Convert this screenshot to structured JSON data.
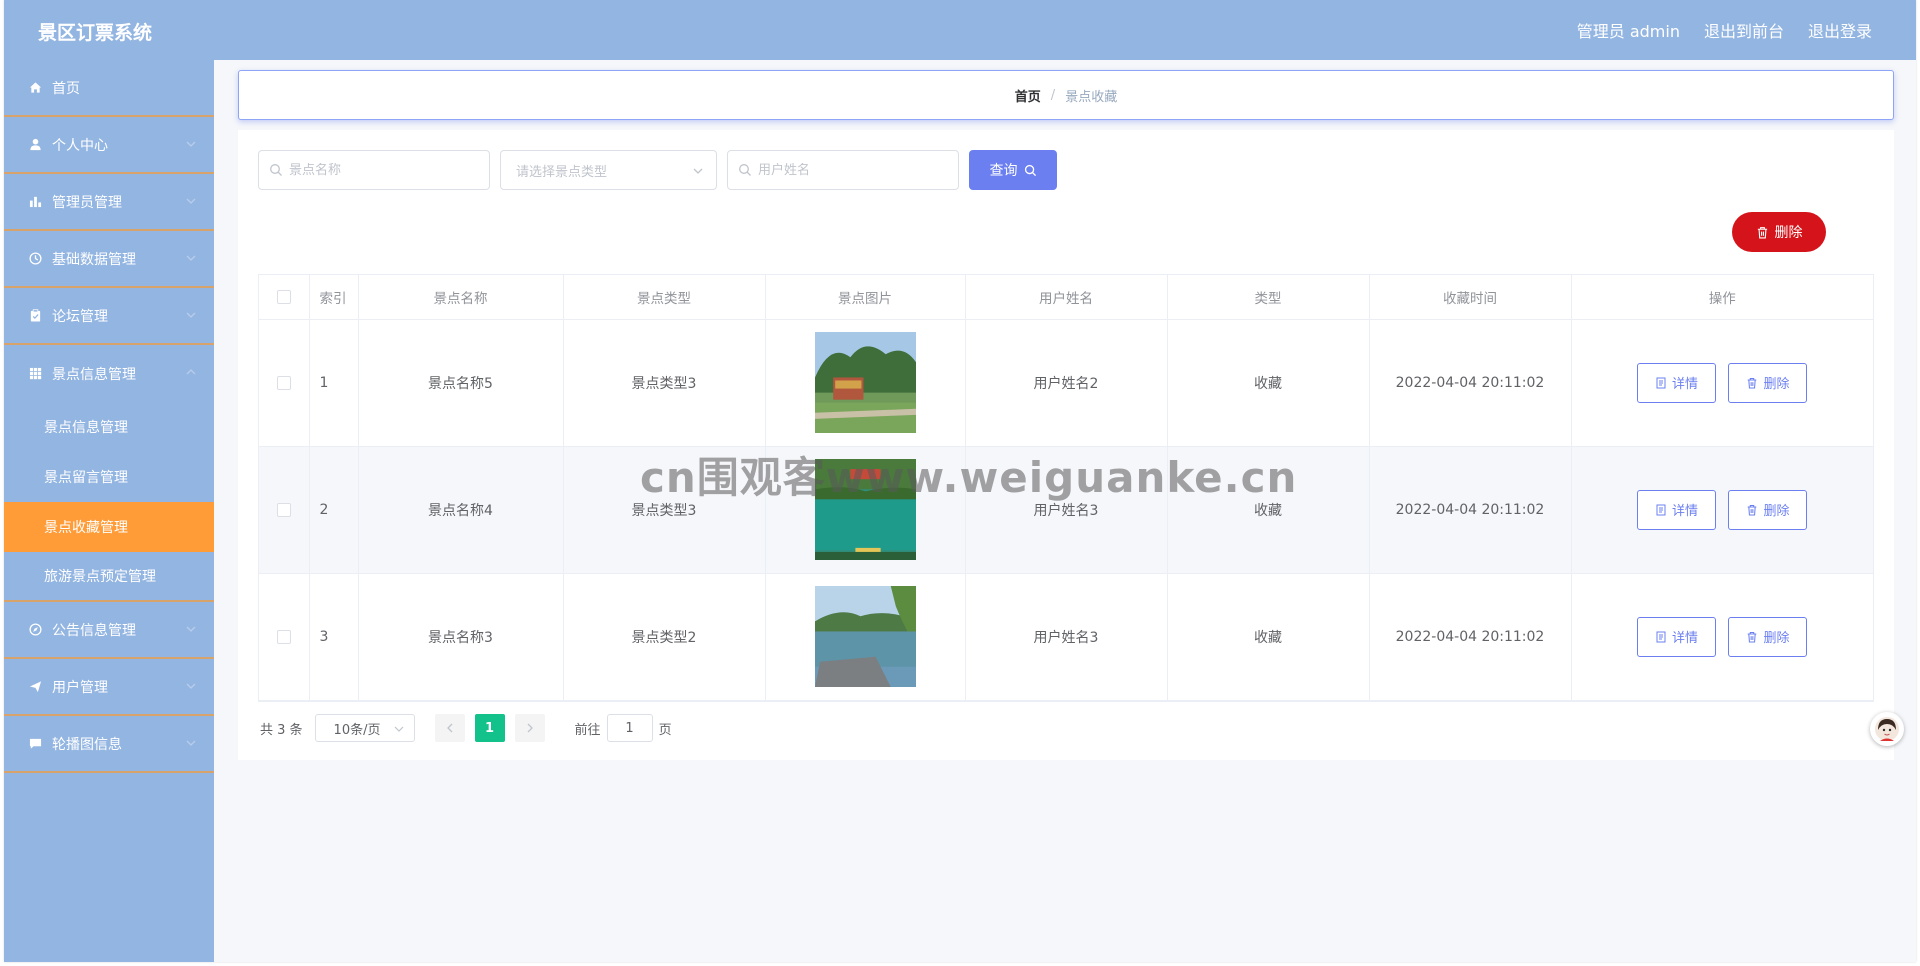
{
  "app": {
    "title": "景区订票系统"
  },
  "topbar": {
    "user_label": "管理员 admin",
    "to_front_label": "退出到前台",
    "logout_label": "退出登录"
  },
  "sidebar": {
    "items": [
      {
        "label": "首页",
        "icon": "home-icon",
        "expandable": false
      },
      {
        "label": "个人中心",
        "icon": "user-icon",
        "expandable": true
      },
      {
        "label": "管理员管理",
        "icon": "bar-chart-icon",
        "expandable": true
      },
      {
        "label": "基础数据管理",
        "icon": "clock-icon",
        "expandable": true
      },
      {
        "label": "论坛管理",
        "icon": "clipboard-icon",
        "expandable": true
      },
      {
        "label": "景点信息管理",
        "icon": "grid-icon",
        "expandable": true,
        "expanded": true
      },
      {
        "label": "公告信息管理",
        "icon": "compass-icon",
        "expandable": true
      },
      {
        "label": "用户管理",
        "icon": "send-icon",
        "expandable": true
      },
      {
        "label": "轮播图信息",
        "icon": "message-icon",
        "expandable": true
      }
    ],
    "sub_items": [
      {
        "label": "景点信息管理",
        "active": false
      },
      {
        "label": "景点留言管理",
        "active": false
      },
      {
        "label": "景点收藏管理",
        "active": true
      },
      {
        "label": "旅游景点预定管理",
        "active": false
      }
    ]
  },
  "breadcrumb": {
    "home": "首页",
    "separator": "/",
    "current": "景点收藏"
  },
  "search": {
    "name_placeholder": "景点名称",
    "type_placeholder": "请选择景点类型",
    "user_placeholder": "用户姓名",
    "query_label": "查询"
  },
  "actions": {
    "delete_label": "删除"
  },
  "table": {
    "headers": [
      "索引",
      "景点名称",
      "景点类型",
      "景点图片",
      "用户姓名",
      "类型",
      "收藏时间",
      "操作"
    ],
    "rows": [
      {
        "index": "1",
        "name": "景点名称5",
        "type": "景点类型3",
        "user": "用户姓名2",
        "kind": "收藏",
        "time": "2022-04-04 20:11:02"
      },
      {
        "index": "2",
        "name": "景点名称4",
        "type": "景点类型3",
        "user": "用户姓名3",
        "kind": "收藏",
        "time": "2022-04-04 20:11:02"
      },
      {
        "index": "3",
        "name": "景点名称3",
        "type": "景点类型2",
        "user": "用户姓名3",
        "kind": "收藏",
        "time": "2022-04-04 20:11:02"
      }
    ],
    "detail_label": "详情",
    "row_delete_label": "删除"
  },
  "pagination": {
    "total_text": "共 3 条",
    "page_size": "10条/页",
    "current_page": "1",
    "goto_label": "前往",
    "goto_value": "1",
    "page_suffix": "页"
  },
  "watermark": "cn围观客www.weiguanke.cn",
  "colors": {
    "topbar": "#93b5e1",
    "sidebar": "#93b5e1",
    "active_menu": "#ff9c38",
    "primary": "#6b7ff0",
    "danger": "#d4141a",
    "pager_active": "#13c28a"
  }
}
